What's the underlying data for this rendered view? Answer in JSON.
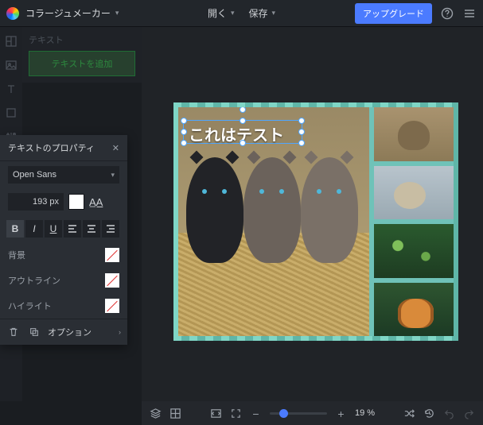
{
  "header": {
    "app_title": "コラージュメーカー",
    "menu_open": "開く",
    "menu_save": "保存",
    "upgrade": "アップグレード"
  },
  "left_panel": {
    "title": "テキスト",
    "add_text": "テキストを追加"
  },
  "props": {
    "title": "テキストのプロパティ",
    "font": "Open Sans",
    "size": "193 px",
    "bg_label": "背景",
    "outline_label": "アウトライン",
    "highlight_label": "ハイライト",
    "options": "オプション"
  },
  "canvas": {
    "text_value": "これはテスト"
  },
  "bottom": {
    "zoom": "19 %"
  }
}
